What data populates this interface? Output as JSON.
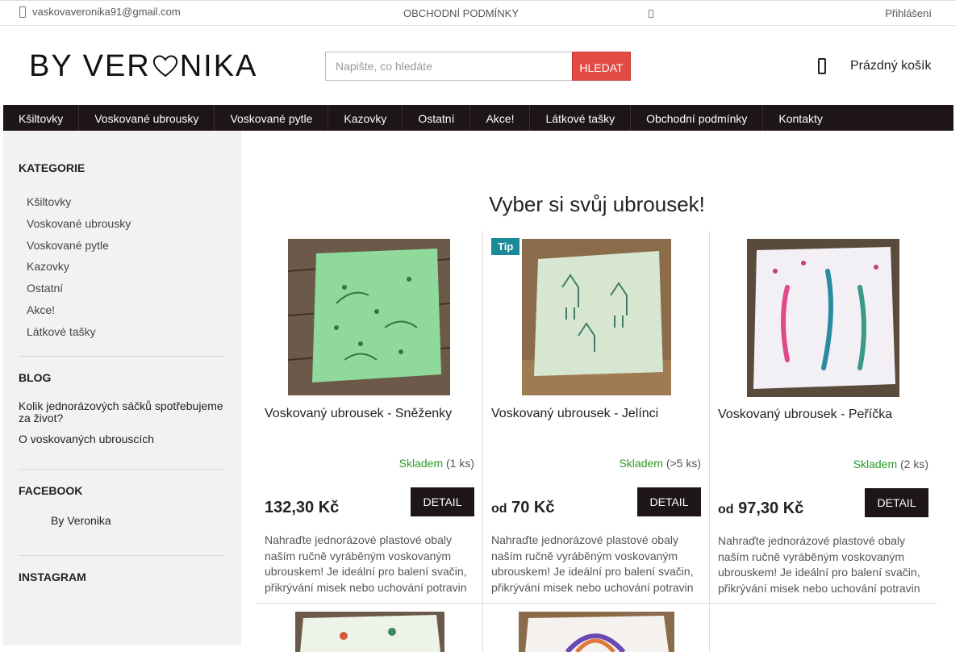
{
  "topbar": {
    "email": "vaskovaveronika91@gmail.com",
    "terms": "OBCHODNÍ PODMÍNKY",
    "login": "Přihlášení"
  },
  "header": {
    "logo_left": "BY VER",
    "logo_right": "NIKA",
    "search_placeholder": "Napište, co hledáte",
    "search_button": "HLEDAT",
    "cart_label": "Prázdný košík"
  },
  "nav": [
    "Kšiltovky",
    "Voskované ubrousky",
    "Voskované pytle",
    "Kazovky",
    "Ostatní",
    "Akce!",
    "Látkové tašky",
    "Obchodní podmínky",
    "Kontakty"
  ],
  "sidebar": {
    "categories_title": "KATEGORIE",
    "categories": [
      "Kšiltovky",
      "Voskované ubrousky",
      "Voskované pytle",
      "Kazovky",
      "Ostatní",
      "Akce!",
      "Látkové tašky"
    ],
    "blog_title": "BLOG",
    "blog": [
      "Kolik jednorázových sáčků spotřebujeme za život?",
      "O voskovaných ubrouscích"
    ],
    "facebook_title": "FACEBOOK",
    "facebook_item": "By Veronika",
    "instagram_title": "INSTAGRAM"
  },
  "main": {
    "title": "Vyber si svůj ubrousek!",
    "products": [
      {
        "name": "Voskovaný ubrousek - Sněženky",
        "stock_status": "Skladem",
        "stock_qty": "(1 ks)",
        "price_prefix": "",
        "price": "132,30 Kč",
        "detail": "DETAIL",
        "description": "Nahraďte jednorázové plastové obaly naším ručně vyráběným voskovaným ubrouskem! Je ideální pro balení svačin, přikrývání misek nebo uchování potravin",
        "tip": "",
        "color": "#8fd99a"
      },
      {
        "name": "Voskovaný ubrousek - Jelínci",
        "stock_status": "Skladem",
        "stock_qty": "(>5 ks)",
        "price_prefix": "od",
        "price": "70 Kč",
        "detail": "DETAIL",
        "description": "Nahraďte jednorázové plastové obaly naším ručně vyráběným voskovaným ubrouskem! Je ideální pro balení svačin, přikrývání misek nebo uchování potravin",
        "tip": "Tip",
        "color": "#d6e6d0"
      },
      {
        "name": "Voskovaný ubrousek - Peříčka",
        "stock_status": "Skladem",
        "stock_qty": "(2 ks)",
        "price_prefix": "od",
        "price": "97,30 Kč",
        "detail": "DETAIL",
        "description": "Nahraďte jednorázové plastové obaly naším ručně vyráběným voskovaným ubrouskem! Je ideální pro balení svačin, přikrývání misek nebo uchování potravin",
        "tip": "",
        "color": "#f2f0f4"
      }
    ]
  }
}
